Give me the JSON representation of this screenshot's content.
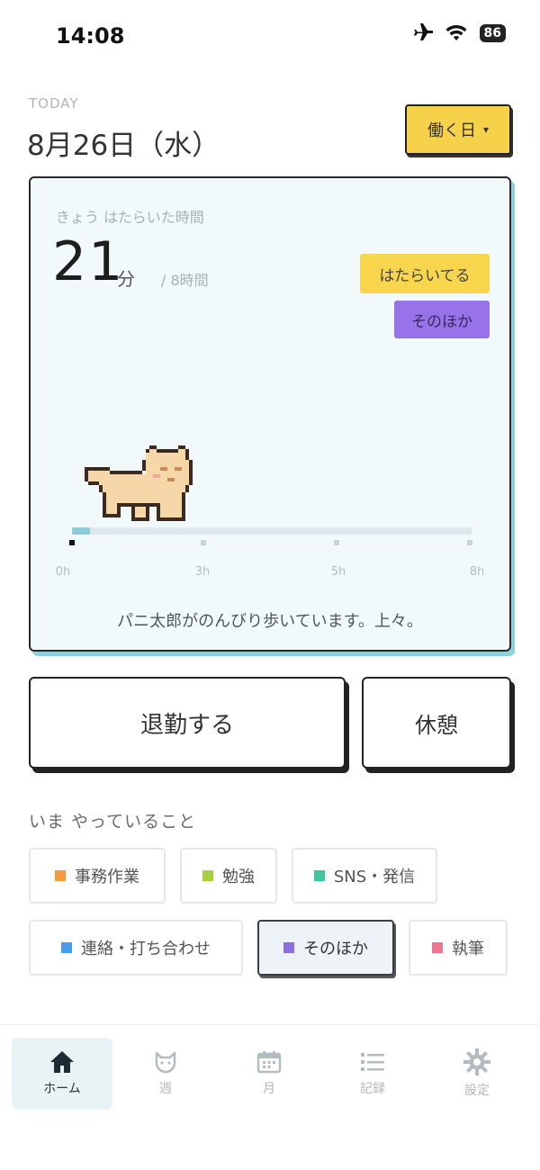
{
  "status_bar": {
    "time": "14:08",
    "battery": "86",
    "icons": [
      "airplane-icon",
      "wifi-icon",
      "battery-icon"
    ]
  },
  "header": {
    "today_label": "TODAY",
    "date": "8月26日（水）",
    "day_type_button": "働く日",
    "day_type_caret": "▾"
  },
  "work_card": {
    "label": "きょう はたらいた時間",
    "worked_value": "21",
    "worked_unit": "分",
    "target": "/ 8時間",
    "progress_fraction": 0.044,
    "legend": {
      "working": "はたらいてる",
      "other": "そのほか"
    },
    "legend_colors": {
      "working": "#f7d64d",
      "other": "#9772e8"
    },
    "ticks": [
      "0h",
      "3h",
      "5h",
      "8h"
    ],
    "message": "パニ太郎がのんびり歩いています。上々。"
  },
  "actions": {
    "leave_button": "退勤する",
    "break_button": "休憩"
  },
  "current_activity": {
    "title": "いま やっていること",
    "chips": [
      {
        "label": "事務作業",
        "color": "#f49a3c",
        "selected": false
      },
      {
        "label": "勉強",
        "color": "#a6cf3d",
        "selected": false
      },
      {
        "label": "SNS・発信",
        "color": "#3fc79a",
        "selected": false
      },
      {
        "label": "連絡・打ち合わせ",
        "color": "#4a9be8",
        "selected": false
      },
      {
        "label": "そのほか",
        "color": "#8e6fe0",
        "selected": true
      },
      {
        "label": "執筆",
        "color": "#ec7592",
        "selected": false
      }
    ]
  },
  "tab_bar": {
    "tabs": [
      {
        "label": "ホーム",
        "icon": "home-icon",
        "active": true
      },
      {
        "label": "週",
        "icon": "cat-face-icon",
        "active": false
      },
      {
        "label": "月",
        "icon": "calendar-icon",
        "active": false
      },
      {
        "label": "記録",
        "icon": "list-icon",
        "active": false
      },
      {
        "label": "設定",
        "icon": "gear-icon",
        "active": false
      }
    ]
  }
}
